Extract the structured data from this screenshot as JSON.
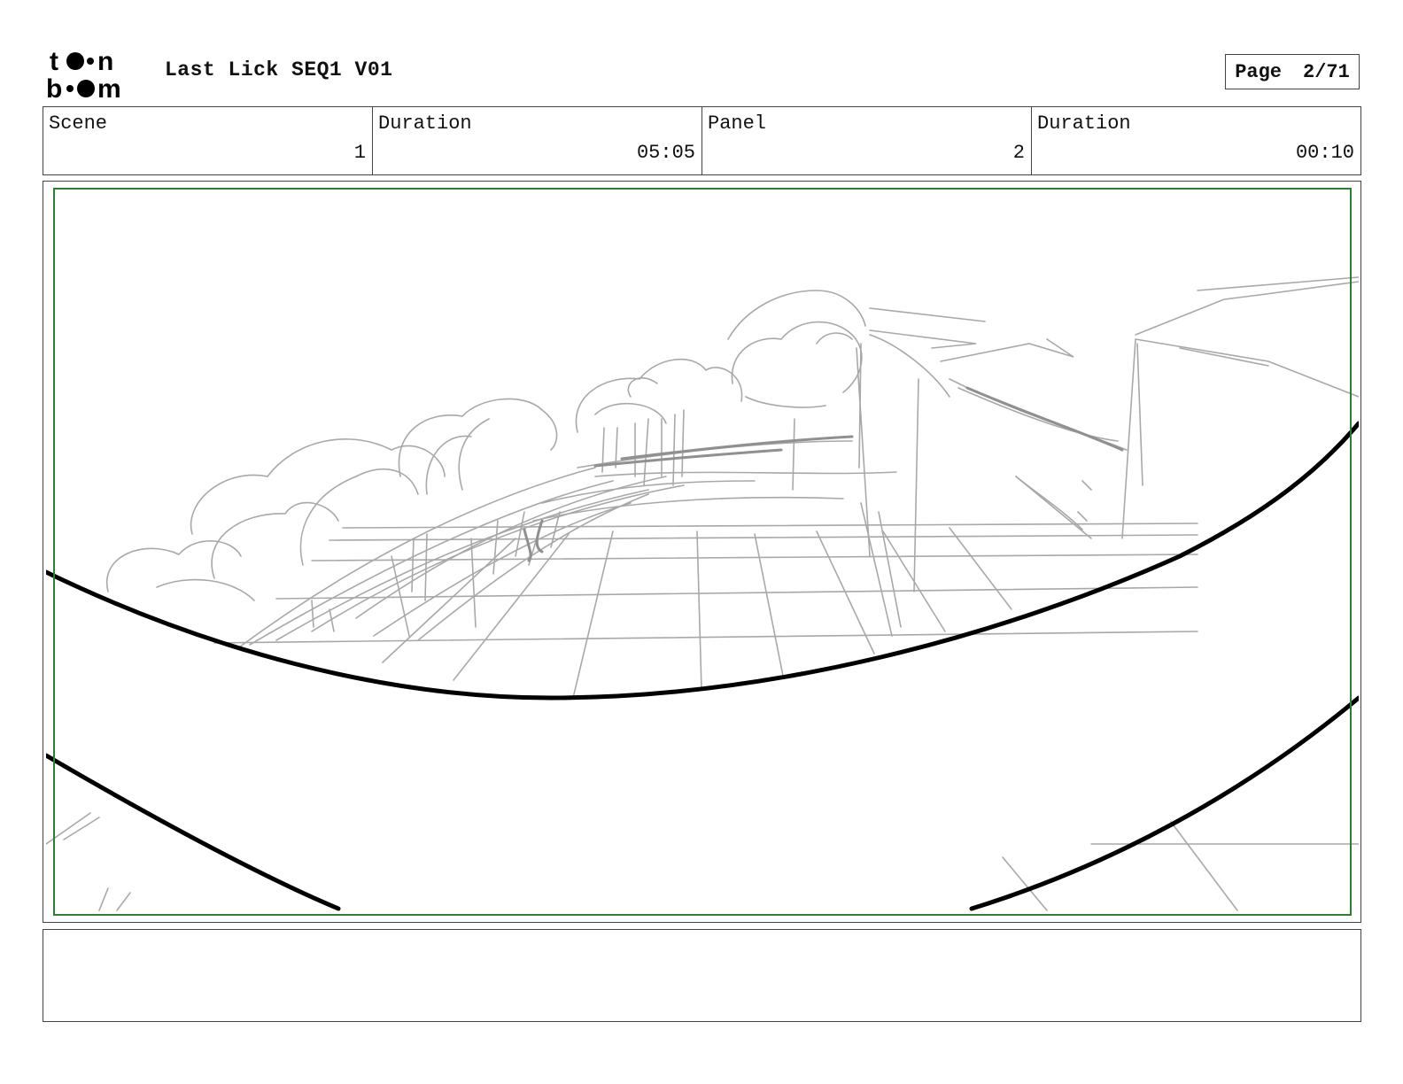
{
  "header": {
    "logo_text": [
      "to",
      "n",
      "b",
      "m"
    ],
    "title": "Last Lick SEQ1 V01",
    "page_label": "Page",
    "page_number": "2/71"
  },
  "info": {
    "scene_label": "Scene",
    "scene_value": "1",
    "scene_duration_label": "Duration",
    "scene_duration_value": "05:05",
    "panel_label": "Panel",
    "panel_value": "2",
    "panel_duration_label": "Duration",
    "panel_duration_value": "00:10"
  },
  "colors": {
    "safe_frame": "#2e7d32",
    "sketch": "#a8a8a8",
    "ink": "#000000"
  },
  "caption": {
    "text": ""
  }
}
